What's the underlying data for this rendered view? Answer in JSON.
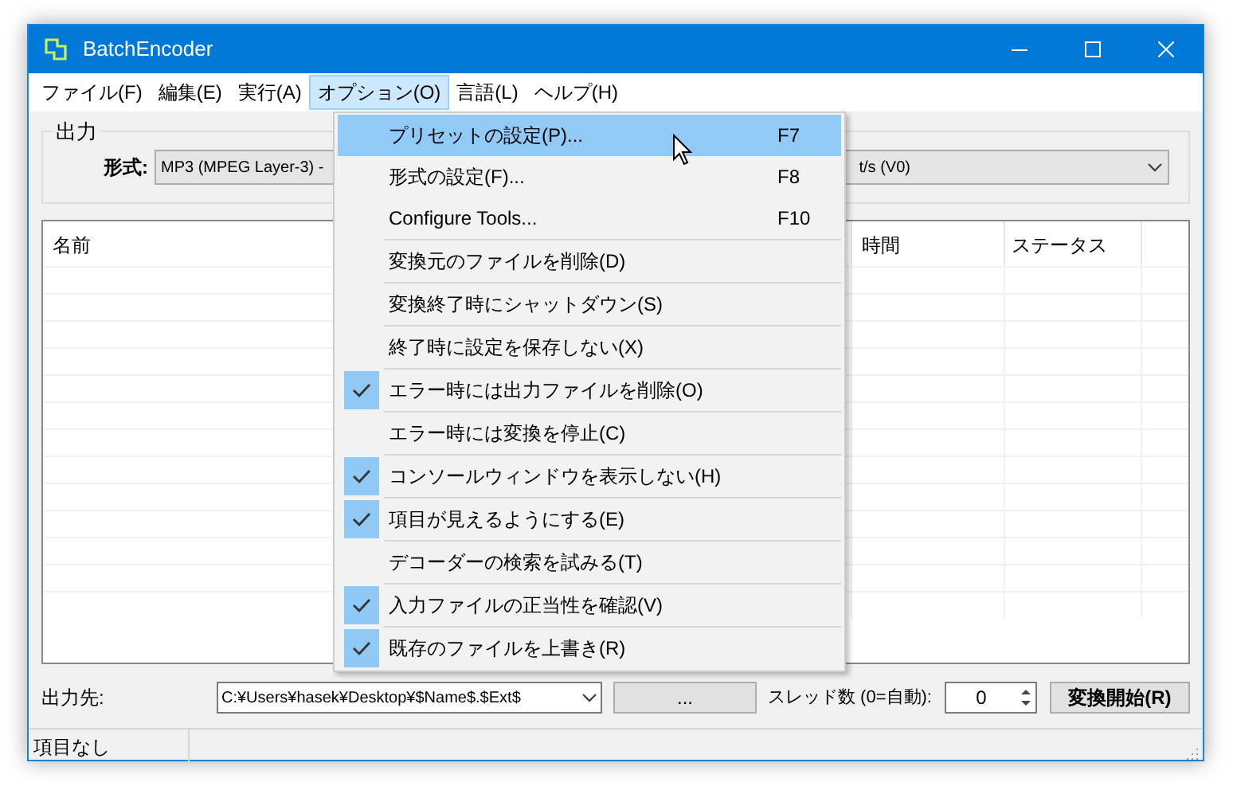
{
  "window": {
    "title": "BatchEncoder"
  },
  "menu_bar": [
    {
      "label": "ファイル(F)",
      "selected": false
    },
    {
      "label": "編集(E)",
      "selected": false
    },
    {
      "label": "実行(A)",
      "selected": false
    },
    {
      "label": "オプション(O)",
      "selected": true
    },
    {
      "label": "言語(L)",
      "selected": false
    },
    {
      "label": "ヘルプ(H)",
      "selected": false
    }
  ],
  "output_group": {
    "title": "出力",
    "format_label": "形式:",
    "format_value": "MP3 (MPEG Layer-3) -",
    "preset_value": "t/s (V0)"
  },
  "table": {
    "columns": [
      "名前",
      "時間",
      "ステータス"
    ]
  },
  "options_menu": [
    {
      "kind": "command",
      "label": "プリセットの設定(P)...",
      "shortcut": "F7",
      "selected": true
    },
    {
      "kind": "command",
      "label": "形式の設定(F)...",
      "shortcut": "F8",
      "selected": false
    },
    {
      "kind": "command",
      "label": "Configure Tools...",
      "shortcut": "F10",
      "selected": false
    },
    {
      "kind": "toggle",
      "label": "変換元のファイルを削除(D)",
      "checked": false,
      "selected": false
    },
    {
      "kind": "toggle",
      "label": "変換終了時にシャットダウン(S)",
      "checked": false,
      "selected": false
    },
    {
      "kind": "toggle",
      "label": "終了時に設定を保存しない(X)",
      "checked": false,
      "selected": false
    },
    {
      "kind": "toggle",
      "label": "エラー時には出力ファイルを削除(O)",
      "checked": true,
      "selected": false
    },
    {
      "kind": "toggle",
      "label": "エラー時には変換を停止(C)",
      "checked": false,
      "selected": false
    },
    {
      "kind": "toggle",
      "label": "コンソールウィンドウを表示しない(H)",
      "checked": true,
      "selected": false
    },
    {
      "kind": "toggle",
      "label": "項目が見えるようにする(E)",
      "checked": true,
      "selected": false
    },
    {
      "kind": "toggle",
      "label": "デコーダーの検索を試みる(T)",
      "checked": false,
      "selected": false
    },
    {
      "kind": "toggle",
      "label": "入力ファイルの正当性を確認(V)",
      "checked": true,
      "selected": false
    },
    {
      "kind": "toggle",
      "label": "既存のファイルを上書き(R)",
      "checked": true,
      "selected": false
    }
  ],
  "bottom": {
    "output_label": "出力先:",
    "output_path": "C:¥Users¥hasek¥Desktop¥$Name$.$Ext$",
    "browse_button": "...",
    "threads_label": "スレッド数 (0=自動):",
    "threads_value": "0",
    "start_button": "変換開始(R)"
  },
  "status_bar": {
    "text": "項目なし"
  }
}
